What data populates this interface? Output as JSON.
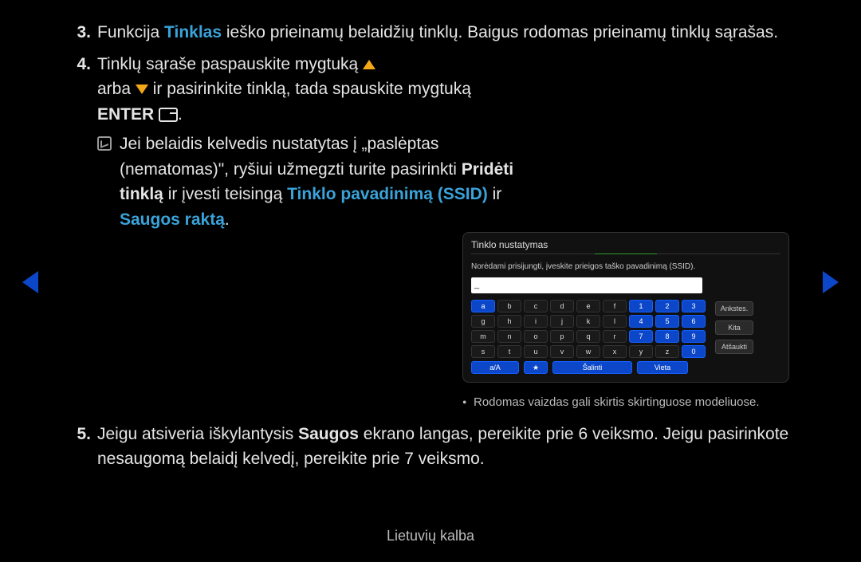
{
  "steps": {
    "s3": {
      "num": "3.",
      "pre": "Funkcija ",
      "term": "Tinklas",
      "post": " ieško prieinamų belaidžių tinklų. Baigus rodomas prieinamų tinklų sąrašas."
    },
    "s4": {
      "num": "4.",
      "line1a": "Tinklų sąraše paspauskite mygtuką ",
      "line2a": "arba ",
      "line2b": " ir pasirinkite tinklą, tada spauskite ",
      "line3a": "mygtuką ",
      "enter": "ENTER",
      "dot": ".",
      "note1": "Jei belaidis kelvedis nustatytas į „paslėptas (nematomas)\", ryšiui užmegzti turite pasirinkti ",
      "note_add": "Pridėti tinklą",
      "note2": " ir įvesti teisingą ",
      "note_ssid": "Tinklo pavadinimą (SSID)",
      "note3": " ir ",
      "note_key": "Saugos raktą",
      "note4": "."
    },
    "s5": {
      "num": "5.",
      "a": "Jeigu atsiveria iškylantysis ",
      "b": "Saugos",
      "c": " ekrano langas, pereikite prie 6 veiksmo. Jeigu pasirinkote nesaugomą belaidį kelvedį, pereikite prie 7 veiksmo."
    }
  },
  "panel": {
    "title": "Tinklo nustatymas",
    "instr": "Norėdami prisijungti, įveskite prieigos taško pavadinimą (SSID).",
    "keys_row1": [
      "a",
      "b",
      "c",
      "d",
      "e",
      "f",
      "1",
      "2",
      "3"
    ],
    "keys_row2": [
      "g",
      "h",
      "i",
      "j",
      "k",
      "l",
      "4",
      "5",
      "6"
    ],
    "keys_row3": [
      "m",
      "n",
      "o",
      "p",
      "q",
      "r",
      "7",
      "8",
      "9"
    ],
    "keys_row4": [
      "s",
      "t",
      "u",
      "v",
      "w",
      "x",
      "y",
      "z",
      "0"
    ],
    "fn": {
      "aA": "a/A",
      "star": "★",
      "del": "Šalinti",
      "space": "Vieta"
    },
    "side": {
      "prev": "Ankstes.",
      "next": "Kita",
      "cancel": "Atšaukti"
    }
  },
  "figure_note": "Rodomas vaizdas gali skirtis skirtinguose modeliuose.",
  "footer": "Lietuvių kalba"
}
